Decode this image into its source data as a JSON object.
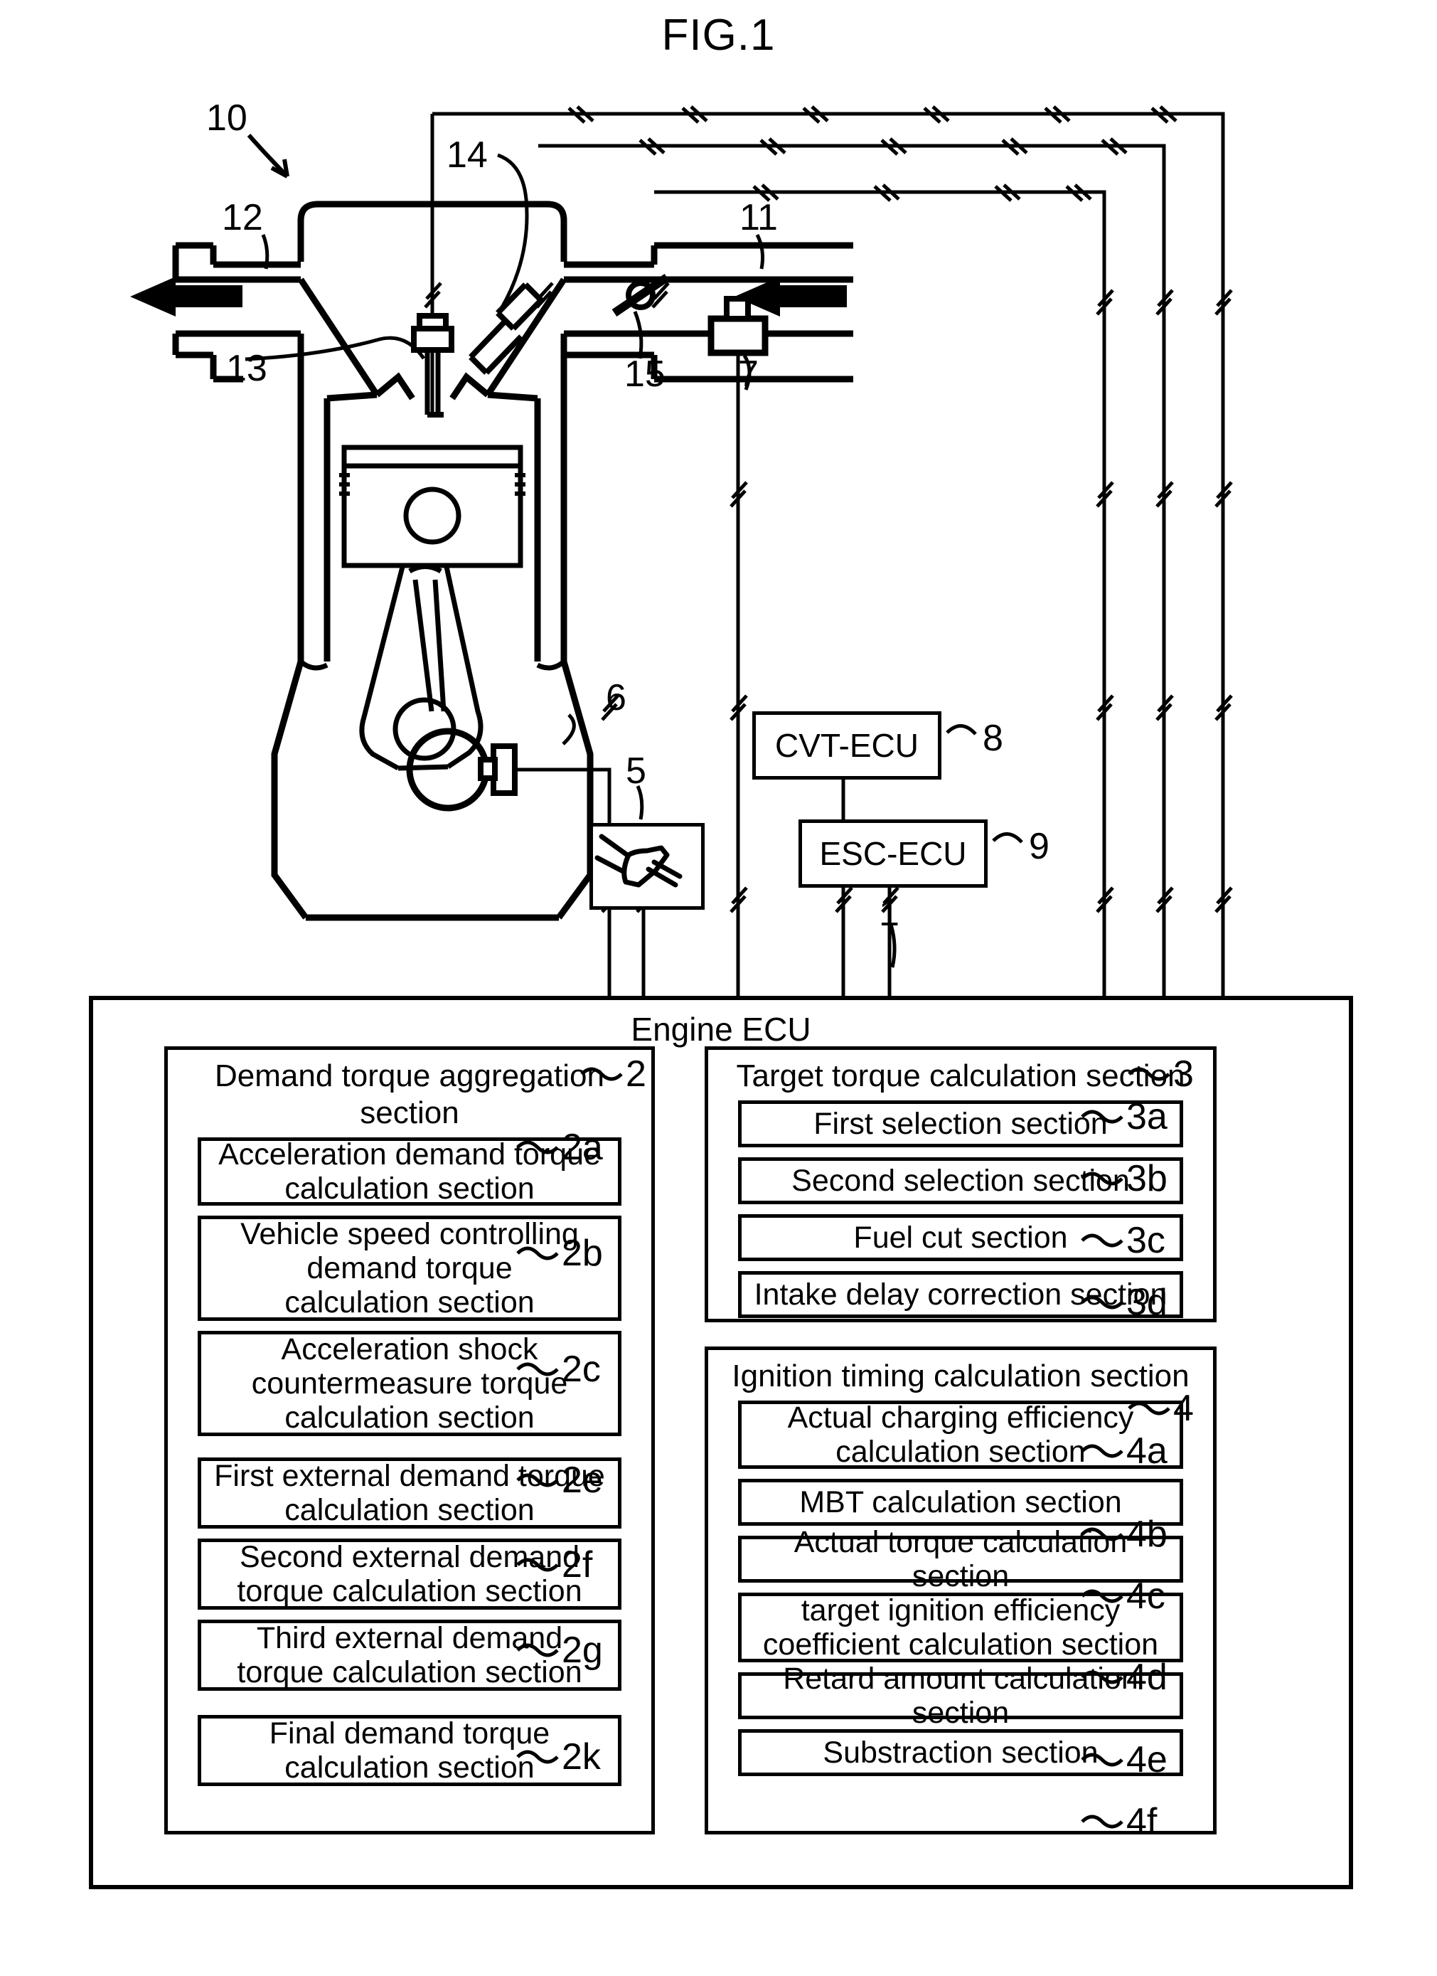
{
  "figure": {
    "title": "FIG.1"
  },
  "engine_diagram": {
    "callouts": [
      {
        "id": "10",
        "label": "10",
        "meaning": "engine-assembly"
      },
      {
        "id": "12",
        "label": "12",
        "meaning": "exhaust-manifold"
      },
      {
        "id": "14",
        "label": "14",
        "meaning": "fuel-injector"
      },
      {
        "id": "11",
        "label": "11",
        "meaning": "intake-manifold"
      },
      {
        "id": "13",
        "label": "13",
        "meaning": "spark-plug"
      },
      {
        "id": "15",
        "label": "15",
        "meaning": "throttle-valve"
      },
      {
        "id": "7",
        "label": "7",
        "meaning": "airflow-sensor"
      },
      {
        "id": "6",
        "label": "6",
        "meaning": "crank-angle-sensor"
      },
      {
        "id": "5",
        "label": "5",
        "meaning": "accelerator-pedal-sensor"
      },
      {
        "id": "8",
        "label": "8",
        "meaning": "cvt-ecu"
      },
      {
        "id": "9",
        "label": "9",
        "meaning": "esc-ecu"
      },
      {
        "id": "1",
        "label": "1",
        "meaning": "engine-ecu"
      }
    ],
    "cvt_ecu_label": "CVT-ECU",
    "esc_ecu_label": "ESC-ECU"
  },
  "engine_ecu": {
    "title": "Engine ECU",
    "tag": "1",
    "groups": [
      {
        "tag": "2",
        "title": "Demand torque aggregation section",
        "items": [
          {
            "tag": "2a",
            "label": "Acceleration demand torque\ncalculation section"
          },
          {
            "tag": "2b",
            "label": "Vehicle speed controlling\ndemand torque\ncalculation section"
          },
          {
            "tag": "2c",
            "label": "Acceleration shock\ncountermeasure torque\ncalculation section"
          },
          {
            "tag": "2e",
            "label": "First external demand torque\ncalculation section"
          },
          {
            "tag": "2f",
            "label": "Second external demand\ntorque calculation section"
          },
          {
            "tag": "2g",
            "label": "Third external demand\ntorque calculation section"
          },
          {
            "tag": "2k",
            "label": "Final demand torque\ncalculation section"
          }
        ]
      },
      {
        "tag": "3",
        "title": "Target torque calculation section",
        "items": [
          {
            "tag": "3a",
            "label": "First selection section"
          },
          {
            "tag": "3b",
            "label": "Second selection section"
          },
          {
            "tag": "3c",
            "label": "Fuel cut section"
          },
          {
            "tag": "3d",
            "label": "Intake delay correction section"
          }
        ]
      },
      {
        "tag": "4",
        "title": "Ignition timing calculation section",
        "items": [
          {
            "tag": "4a",
            "label": "Actual charging efficiency\ncalculation section"
          },
          {
            "tag": "4b",
            "label": "MBT calculation section"
          },
          {
            "tag": "4c",
            "label": "Actual torque calculation section"
          },
          {
            "tag": "4d",
            "label": "target ignition efficiency\ncoefficient calculation section"
          },
          {
            "tag": "4e",
            "label": "Retard amount calculation section"
          },
          {
            "tag": "4f",
            "label": "Substraction section"
          }
        ]
      }
    ]
  },
  "colors": {
    "line": "#000000",
    "background": "#ffffff"
  }
}
